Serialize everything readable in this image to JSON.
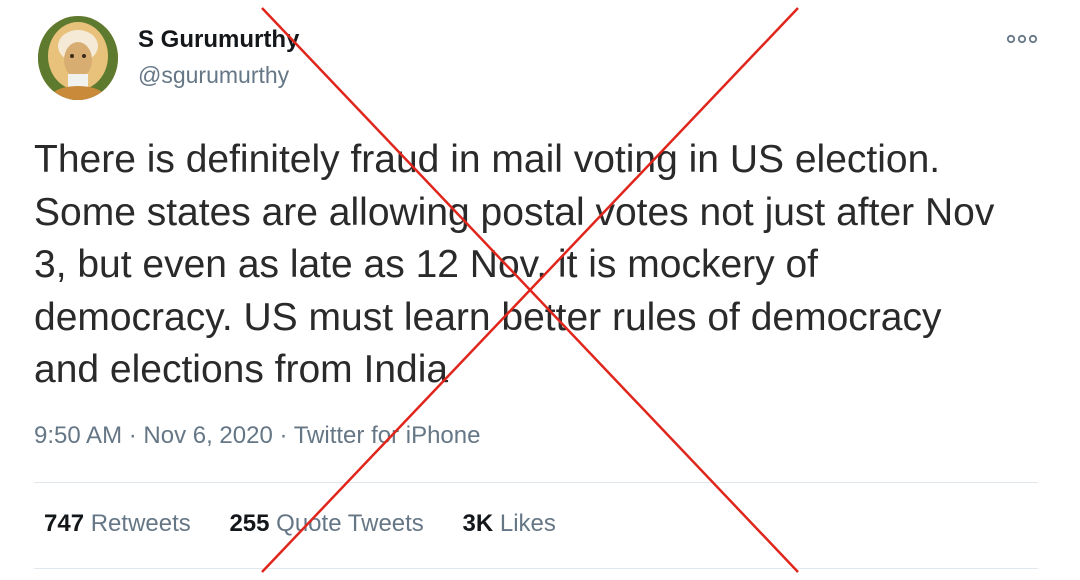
{
  "tweet": {
    "author": {
      "display_name": "S Gurumurthy",
      "handle": "@sgurumurthy",
      "avatar_icon": "profile-photo"
    },
    "text_lines": [
      "There is definitely fraud in mail voting in US election.",
      "Some states are allowing postal votes not just after Nov",
      "3, but even as late as 12 Nov. it is mockery of",
      "democracy. US must learn better rules of democracy",
      "and elections from India"
    ],
    "meta": {
      "time": "9:50 AM",
      "separator": " · ",
      "date": "Nov 6, 2020",
      "source": "Twitter for iPhone"
    },
    "stats": [
      {
        "count": "747",
        "label": "Retweets"
      },
      {
        "count": "255",
        "label": "Quote Tweets"
      },
      {
        "count": "3K",
        "label": "Likes"
      }
    ]
  },
  "colors": {
    "cross": "#e0261c",
    "secondary_text": "#657786",
    "primary_text": "#14171a",
    "divider": "#e1e8ed"
  }
}
